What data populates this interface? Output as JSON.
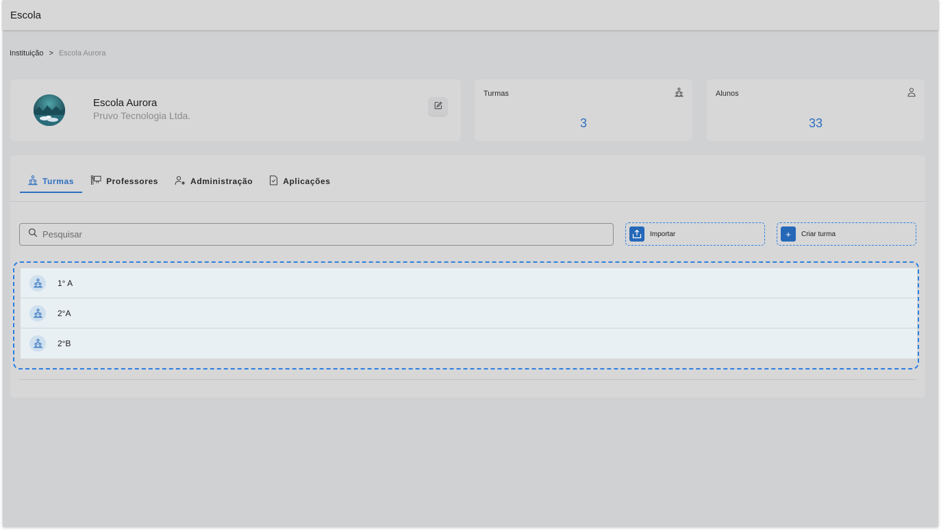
{
  "app": {
    "title": "Escola"
  },
  "breadcrumb": {
    "root": "Instituição",
    "separator": ">",
    "current": "Escola Aurora"
  },
  "school": {
    "name": "Escola Aurora",
    "organization": "Pruvo Tecnologia Ltda."
  },
  "stats": {
    "turmas": {
      "label": "Turmas",
      "value": "3",
      "icon": "group-icon"
    },
    "alunos": {
      "label": "Alunos",
      "value": "33",
      "icon": "person-icon"
    }
  },
  "tabs": [
    {
      "label": "Turmas",
      "icon": "group-icon",
      "active": true
    },
    {
      "label": "Professores",
      "icon": "teacher-board-icon",
      "active": false
    },
    {
      "label": "Administração",
      "icon": "admin-user-icon",
      "active": false
    },
    {
      "label": "Aplicações",
      "icon": "checked-document-icon",
      "active": false
    }
  ],
  "search": {
    "placeholder": "Pesquisar",
    "value": ""
  },
  "actions": {
    "import_label": "Importar",
    "create_label": "Criar turma",
    "create_symbol": "+"
  },
  "classes": [
    {
      "name": "1° A"
    },
    {
      "name": "2°A"
    },
    {
      "name": "2°B"
    }
  ],
  "colors": {
    "accent": "#2d6fbf",
    "highlight_dashed": "#2b7fe0",
    "row_bg": "#e9f0f4"
  }
}
